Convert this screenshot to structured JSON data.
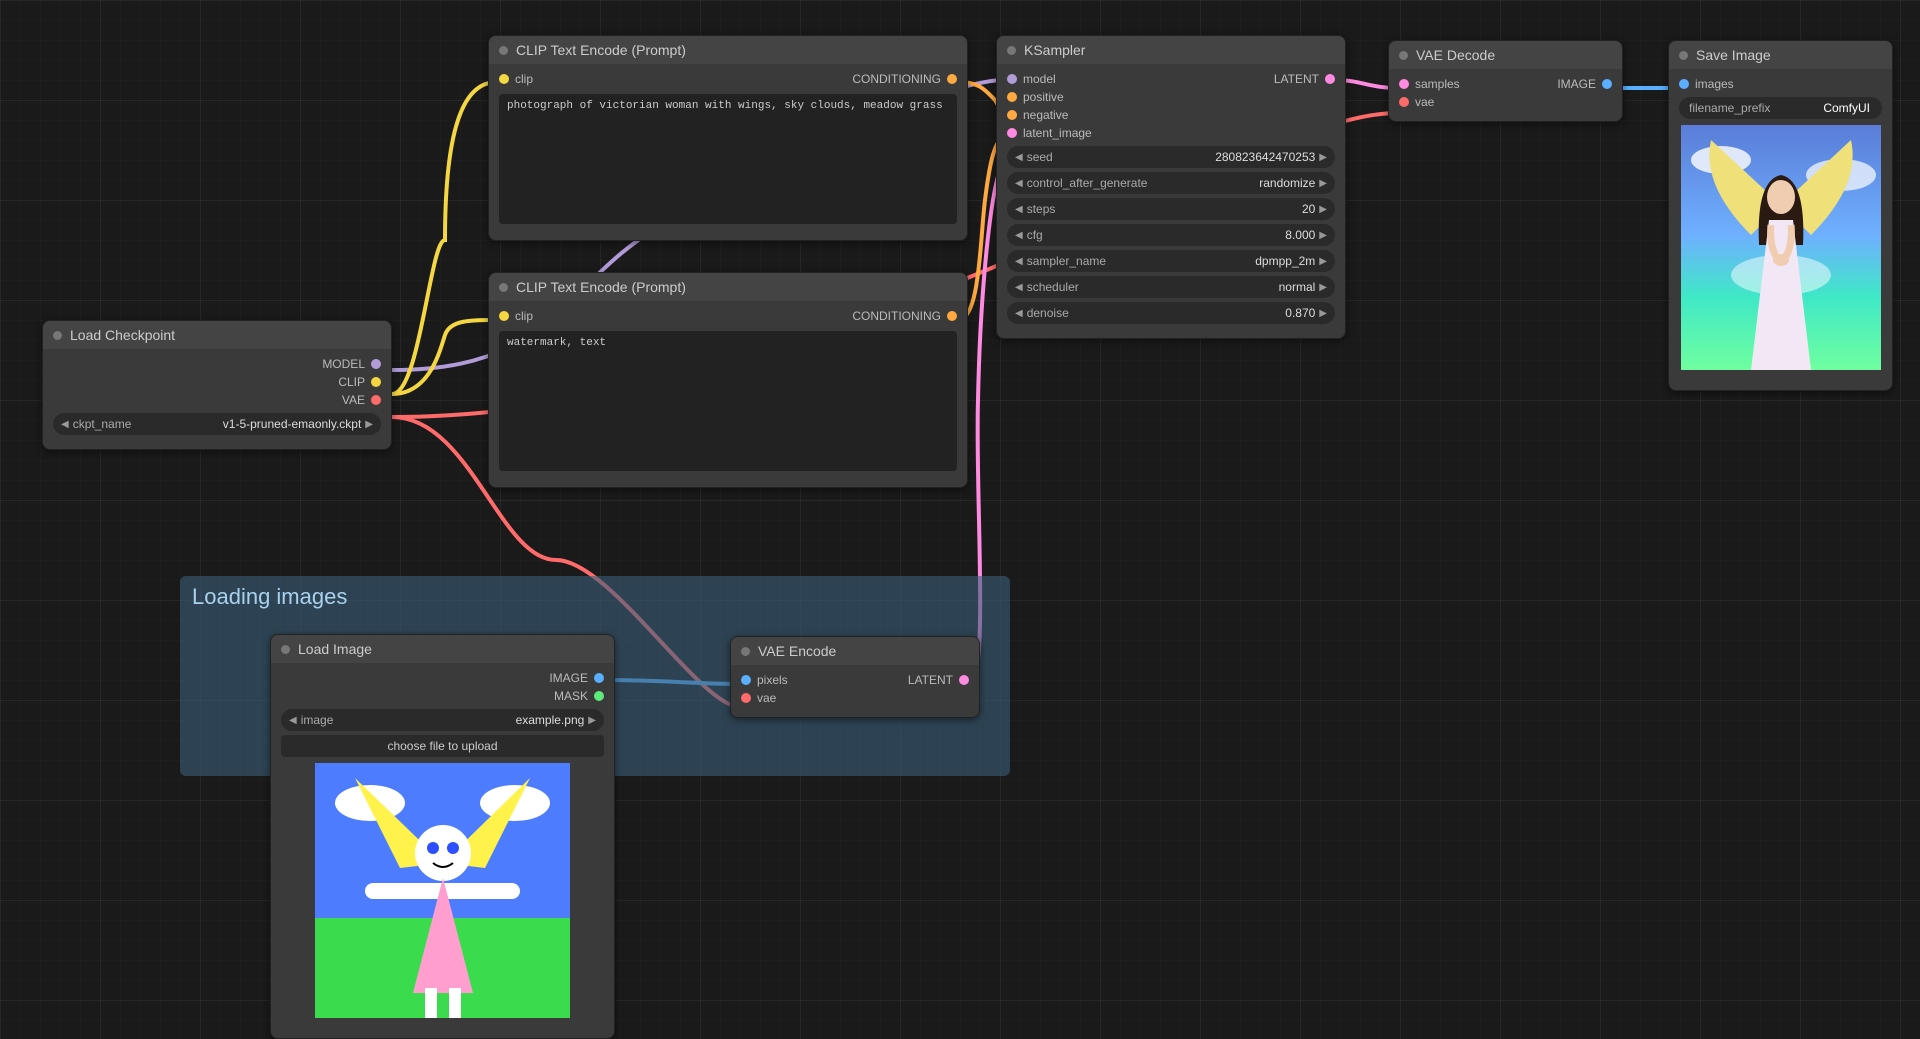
{
  "group": {
    "title": "Loading images"
  },
  "nodes": {
    "checkpoint": {
      "title": "Load Checkpoint",
      "outputs": {
        "model": "MODEL",
        "clip": "CLIP",
        "vae": "VAE"
      },
      "ckpt_label": "ckpt_name",
      "ckpt_value": "v1-5-pruned-emaonly.ckpt"
    },
    "clip_pos": {
      "title": "CLIP Text Encode (Prompt)",
      "in": "clip",
      "out": "CONDITIONING",
      "text": "photograph of victorian woman with wings, sky clouds, meadow grass"
    },
    "clip_neg": {
      "title": "CLIP Text Encode (Prompt)",
      "in": "clip",
      "out": "CONDITIONING",
      "text": "watermark, text"
    },
    "load_image": {
      "title": "Load Image",
      "out_image": "IMAGE",
      "out_mask": "MASK",
      "image_label": "image",
      "image_value": "example.png",
      "upload": "choose file to upload"
    },
    "vae_encode": {
      "title": "VAE Encode",
      "in_pixels": "pixels",
      "in_vae": "vae",
      "out": "LATENT"
    },
    "ksampler": {
      "title": "KSampler",
      "in_model": "model",
      "in_positive": "positive",
      "in_negative": "negative",
      "in_latent": "latent_image",
      "out": "LATENT",
      "seed_label": "seed",
      "seed_value": "280823642470253",
      "ctrl_label": "control_after_generate",
      "ctrl_value": "randomize",
      "steps_label": "steps",
      "steps_value": "20",
      "cfg_label": "cfg",
      "cfg_value": "8.000",
      "sampler_label": "sampler_name",
      "sampler_value": "dpmpp_2m",
      "sched_label": "scheduler",
      "sched_value": "normal",
      "denoise_label": "denoise",
      "denoise_value": "0.870"
    },
    "vae_decode": {
      "title": "VAE Decode",
      "in_samples": "samples",
      "in_vae": "vae",
      "out": "IMAGE"
    },
    "save_image": {
      "title": "Save Image",
      "in_images": "images",
      "prefix_label": "filename_prefix",
      "prefix_value": "ComfyUI"
    }
  }
}
